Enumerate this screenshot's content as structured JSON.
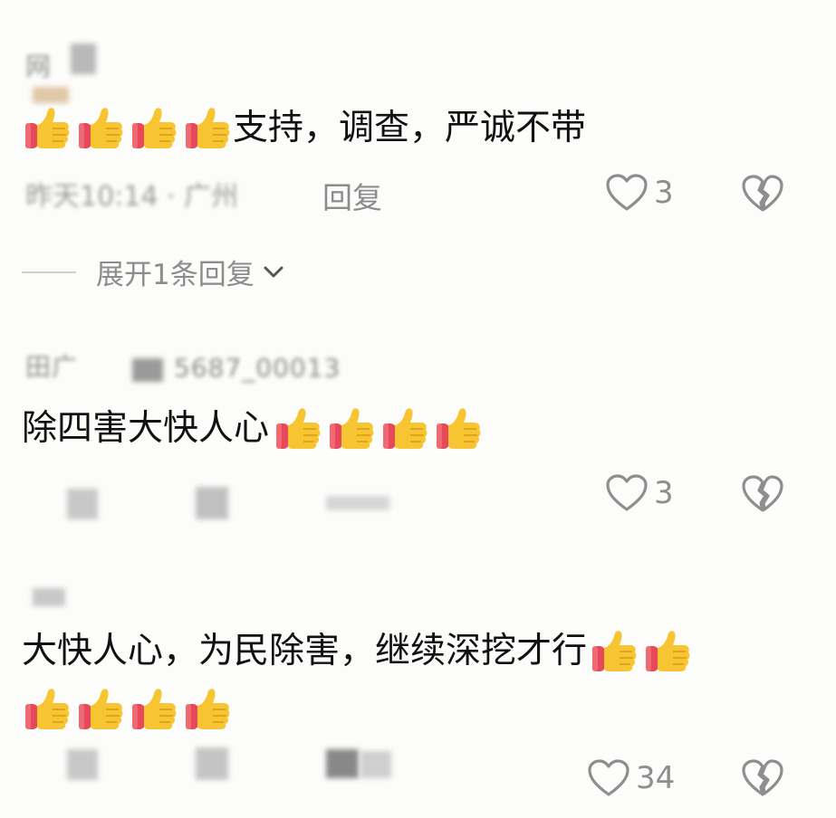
{
  "comments": [
    {
      "username": "网",
      "text": "支持，调查，严诚不带",
      "emoji_before": 4,
      "emoji_after": 0,
      "time": "昨天10:14 · 广州",
      "reply_label": "回复",
      "like_count": "3"
    },
    {
      "username": "田广",
      "user_id": "5687_00013",
      "text": "除四害大快人心",
      "emoji_before": 0,
      "emoji_after": 4,
      "like_count": "3"
    },
    {
      "text": "大快人心，为民除害，继续深挖才行",
      "emoji_after_line1": 2,
      "emoji_line2": 4,
      "like_count": "34"
    }
  ],
  "expand_replies": {
    "label": "展开1条回复"
  },
  "icons": {
    "like": "heart-outline-icon",
    "dislike": "broken-heart-icon",
    "emoji": "thumbs-up-emoji",
    "chevron": "chevron-down-icon"
  },
  "colors": {
    "thumb_yellow": "#f7c531",
    "thumb_cuff": "#e8495a",
    "icon_gray": "#8e8e8e"
  }
}
